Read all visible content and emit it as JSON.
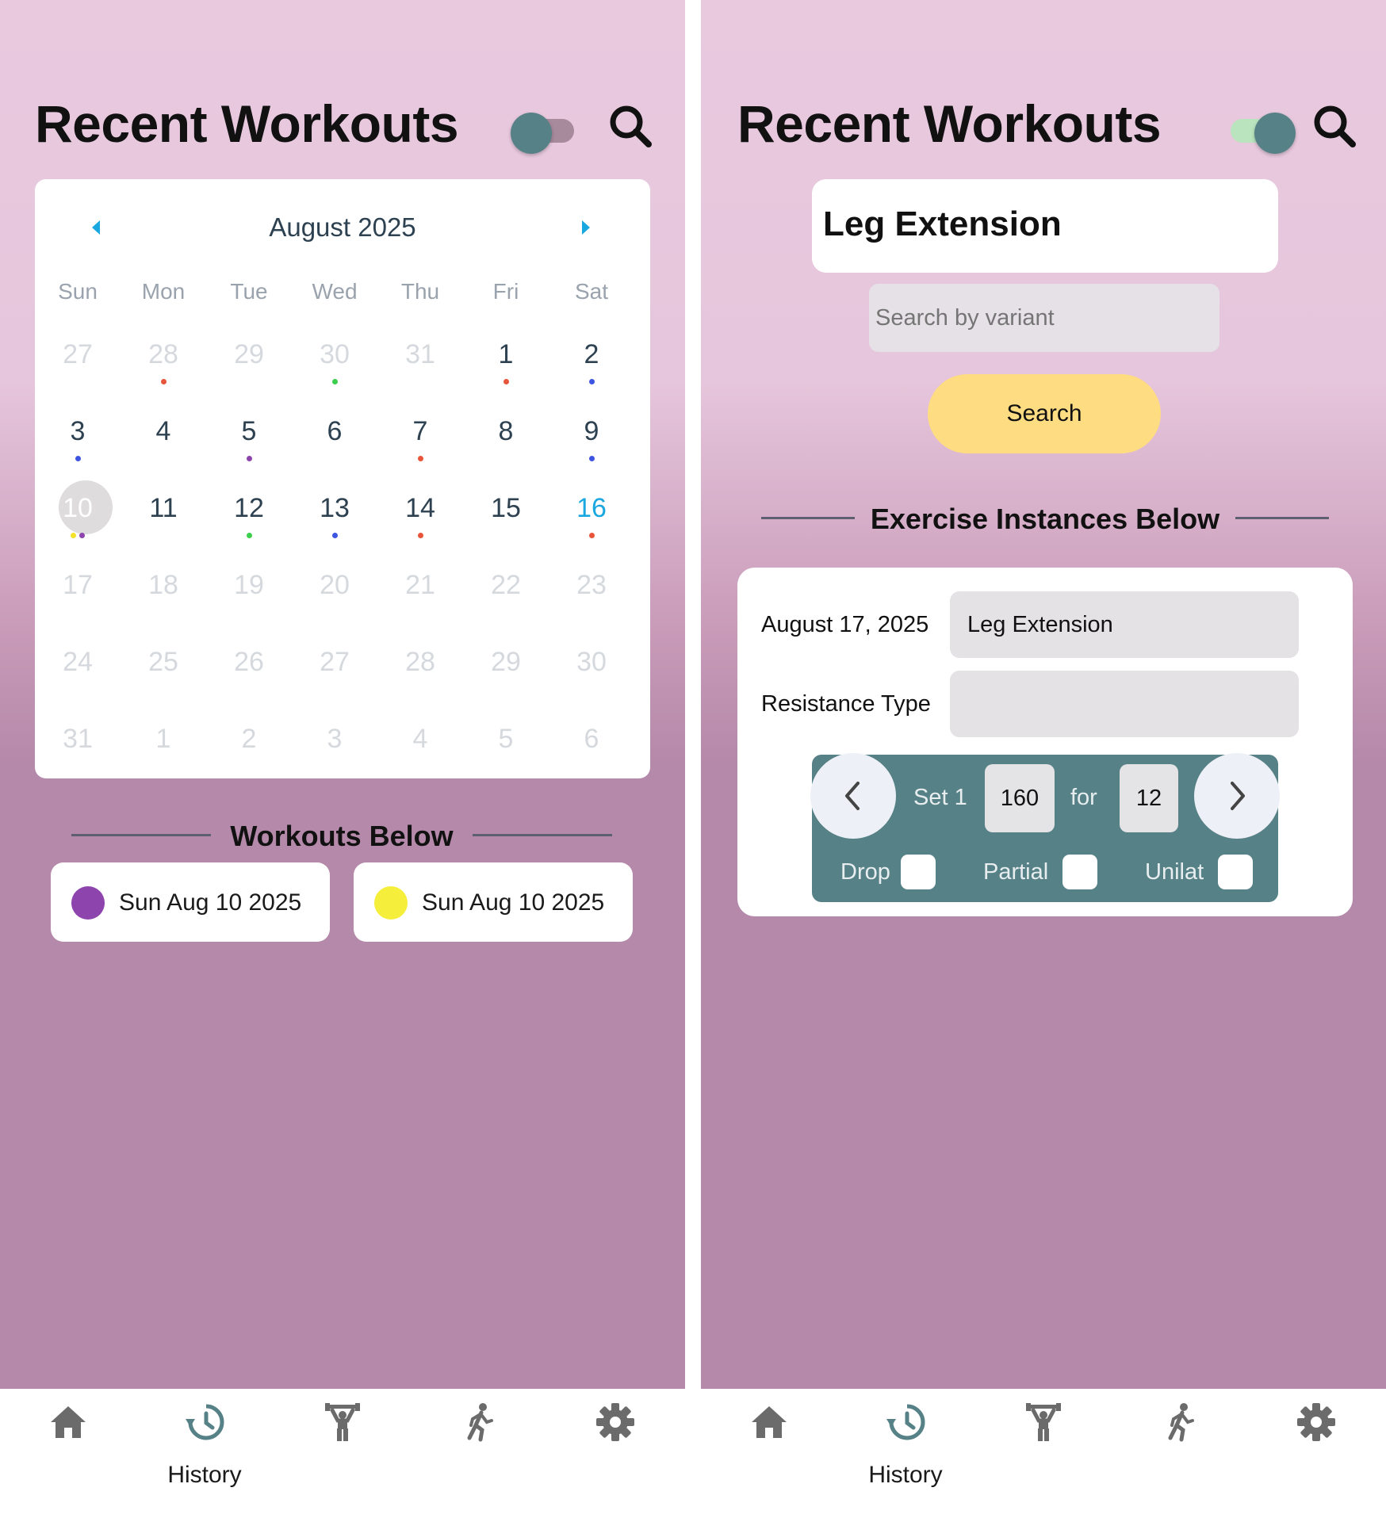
{
  "colors": {
    "accent_teal": "#568186",
    "search_button": "#fedc82",
    "calendar_today_blue": "#19a7e0"
  },
  "left": {
    "title": "Recent Workouts",
    "toggle_on": false,
    "calendar": {
      "month_label": "August 2025",
      "weekdays": [
        "Sun",
        "Mon",
        "Tue",
        "Wed",
        "Thu",
        "Fri",
        "Sat"
      ],
      "weeks": [
        [
          {
            "d": "27",
            "dim": true
          },
          {
            "d": "28",
            "dim": true,
            "dots": [
              "#e8553a"
            ]
          },
          {
            "d": "29",
            "dim": true
          },
          {
            "d": "30",
            "dim": true,
            "dots": [
              "#3ccf4e"
            ]
          },
          {
            "d": "31",
            "dim": true
          },
          {
            "d": "1",
            "dots": [
              "#e8553a"
            ]
          },
          {
            "d": "2",
            "dots": [
              "#3d55e0"
            ]
          }
        ],
        [
          {
            "d": "3",
            "dots": [
              "#3d55e0"
            ]
          },
          {
            "d": "4"
          },
          {
            "d": "5",
            "dots": [
              "#8e44ad"
            ]
          },
          {
            "d": "6"
          },
          {
            "d": "7",
            "dots": [
              "#e8553a"
            ]
          },
          {
            "d": "8"
          },
          {
            "d": "9",
            "dots": [
              "#3d55e0"
            ]
          }
        ],
        [
          {
            "d": "10",
            "today": true,
            "dots": [
              "#f3e12a",
              "#8e44ad"
            ]
          },
          {
            "d": "11"
          },
          {
            "d": "12",
            "dots": [
              "#3ccf4e"
            ]
          },
          {
            "d": "13",
            "dots": [
              "#3d55e0"
            ]
          },
          {
            "d": "14",
            "dots": [
              "#e8553a"
            ]
          },
          {
            "d": "15"
          },
          {
            "d": "16",
            "highlight": true,
            "dots": [
              "#e8553a"
            ]
          }
        ],
        [
          {
            "d": "17",
            "dim": true
          },
          {
            "d": "18",
            "dim": true
          },
          {
            "d": "19",
            "dim": true
          },
          {
            "d": "20",
            "dim": true
          },
          {
            "d": "21",
            "dim": true
          },
          {
            "d": "22",
            "dim": true
          },
          {
            "d": "23",
            "dim": true
          }
        ],
        [
          {
            "d": "24",
            "dim": true
          },
          {
            "d": "25",
            "dim": true
          },
          {
            "d": "26",
            "dim": true
          },
          {
            "d": "27",
            "dim": true
          },
          {
            "d": "28",
            "dim": true
          },
          {
            "d": "29",
            "dim": true
          },
          {
            "d": "30",
            "dim": true
          }
        ],
        [
          {
            "d": "31",
            "dim": true
          },
          {
            "d": "1",
            "dim": true
          },
          {
            "d": "2",
            "dim": true
          },
          {
            "d": "3",
            "dim": true
          },
          {
            "d": "4",
            "dim": true
          },
          {
            "d": "5",
            "dim": true
          },
          {
            "d": "6",
            "dim": true
          }
        ]
      ]
    },
    "workouts_heading": "Workouts Below",
    "workouts": [
      {
        "label": "Sun Aug 10 2025",
        "color": "#8e44ad"
      },
      {
        "label": "Sun Aug 10 2025",
        "color": "#f5ee3a"
      }
    ]
  },
  "right": {
    "title": "Recent Workouts",
    "toggle_on": true,
    "exercise_name": "Leg Extension",
    "variant_placeholder": "Search by variant",
    "search_button": "Search",
    "instances_heading": "Exercise Instances Below",
    "instance": {
      "date": "August 17, 2025",
      "exercise": "Leg Extension",
      "resistance_label": "Resistance Type",
      "resistance_value": "",
      "set_label": "Set 1",
      "weight": "160",
      "for_label": "for",
      "reps": "12",
      "drop_label": "Drop",
      "partial_label": "Partial",
      "unilat_label": "Unilat"
    }
  },
  "nav": {
    "items": [
      {
        "icon": "home-icon"
      },
      {
        "icon": "history-icon",
        "label": "History",
        "active": true
      },
      {
        "icon": "weightlifter-icon"
      },
      {
        "icon": "runner-icon"
      },
      {
        "icon": "gear-icon"
      }
    ]
  }
}
